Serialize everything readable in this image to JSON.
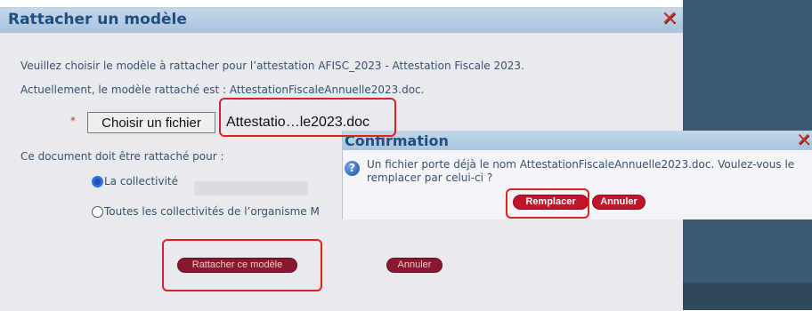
{
  "main_dialog": {
    "title": "Rattacher un modèle",
    "close_symbol": "✕",
    "line1": "Veuillez choisir le modèle à rattacher pour l’attestation AFISC_2023 - Attestation Fiscale 2023.",
    "line2": "Actuellement, le modèle rattaché est : AttestationFiscaleAnnuelle2023.doc.",
    "required_mark": "*",
    "file_button_label": "Choisir un fichier",
    "file_name": "Attestatio…le2023.doc",
    "scope_label": "Ce document doit être rattaché pour :",
    "option1_label": "La collectivité",
    "option2_label": "Toutes les collectivités de l’organisme M",
    "attach_button": "Rattacher ce modèle",
    "cancel_button": "Annuler"
  },
  "confirm_dialog": {
    "title": "Confirmation",
    "close_symbol": "✕",
    "icon_glyph": "?",
    "message": "Un fichier porte déjà le nom AttestationFiscaleAnnuelle2023.doc. Voulez-vous le remplacer par celui-ci ?",
    "replace_button": "Remplacer",
    "cancel_button": "Annuler"
  },
  "icons": {
    "main_close": "close-icon",
    "confirm_close": "close-icon",
    "question": "question-icon"
  },
  "colors": {
    "title_text": "#1f4f80",
    "body_text": "#3b4f6b",
    "button_dark": "#8a1830",
    "button_bright": "#c4142c",
    "highlight": "#e02020",
    "close_red": "#c0392b"
  }
}
